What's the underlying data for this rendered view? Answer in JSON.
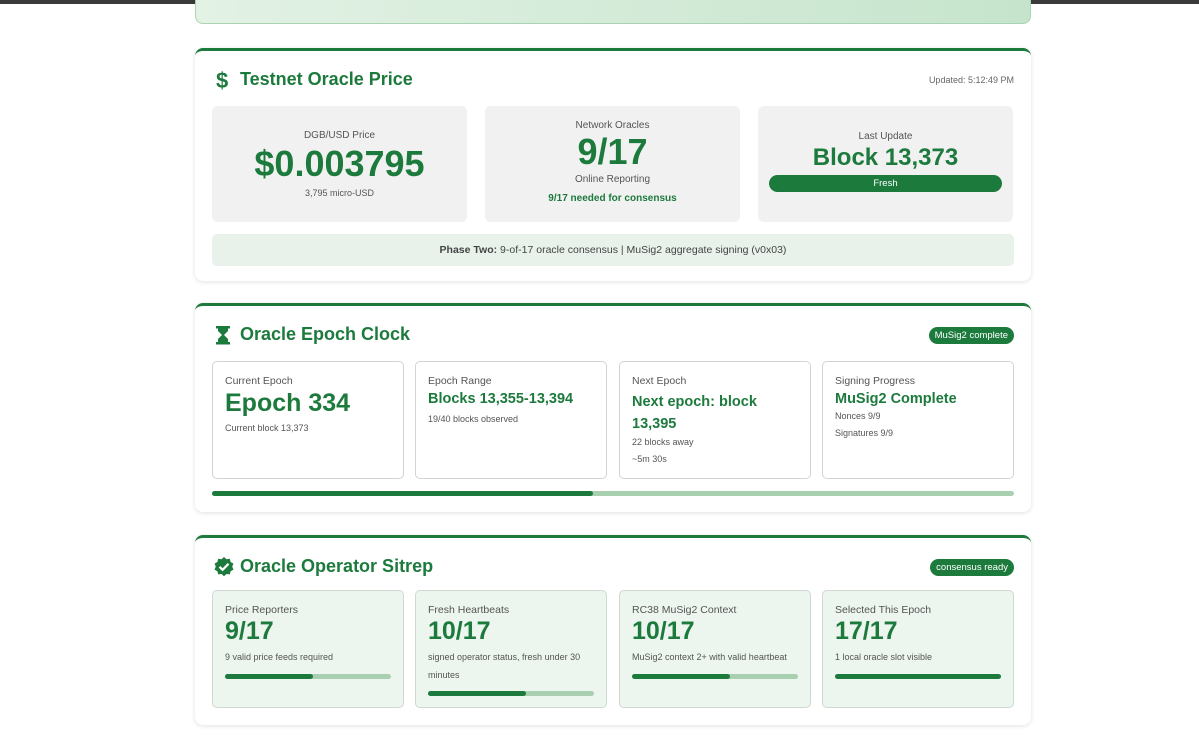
{
  "price_card": {
    "title": "Testnet Oracle Price",
    "icon": "dollar-icon",
    "updated": "Updated: 5:12:49 PM",
    "price": {
      "label": "DGB/USD Price",
      "value": "$0.003795",
      "sub": "3,795 micro-USD"
    },
    "oracles": {
      "label": "Network Oracles",
      "value": "9/17",
      "sub": "Online Reporting",
      "note": "9/17 needed for consensus"
    },
    "last_update": {
      "label": "Last Update",
      "value": "Block 13,373",
      "status": "Fresh"
    },
    "phase_bold": "Phase Two:",
    "phase_text": " 9-of-17 oracle consensus | MuSig2 aggregate signing (v0x03)"
  },
  "epoch_card": {
    "title": "Oracle Epoch Clock",
    "icon": "hourglass-icon",
    "badge": "MuSig2 complete",
    "current": {
      "label": "Current Epoch",
      "value": "Epoch 334",
      "sub": "Current block 13,373"
    },
    "range": {
      "label": "Epoch Range",
      "value": "Blocks 13,355-13,394",
      "sub": "19/40 blocks observed"
    },
    "next": {
      "label": "Next Epoch",
      "value": "Next epoch: block 13,395",
      "sub1": "22 blocks away",
      "sub2": "~5m 30s"
    },
    "signing": {
      "label": "Signing Progress",
      "value": "MuSig2 Complete",
      "sub1": "Nonces 9/9",
      "sub2": "Signatures 9/9"
    },
    "progress": 0.475
  },
  "sitrep_card": {
    "title": "Oracle Operator Sitrep",
    "icon": "verified-check-icon",
    "badge": "consensus ready",
    "items": [
      {
        "label": "Price Reporters",
        "value": "9/17",
        "sub": "9 valid price feeds required",
        "progress": 0.53
      },
      {
        "label": "Fresh Heartbeats",
        "value": "10/17",
        "sub": "signed operator status, fresh under 30 minutes",
        "progress": 0.59
      },
      {
        "label": "RC38 MuSig2 Context",
        "value": "10/17",
        "sub": "MuSig2 context 2+ with valid heartbeat",
        "progress": 0.59
      },
      {
        "label": "Selected This Epoch",
        "value": "17/17",
        "sub": "1 local oracle slot visible",
        "progress": 1.0
      }
    ]
  },
  "colors": {
    "accent": "#1d7a3d",
    "accent_light": "#a8d0b0",
    "panel": "#f1f1f1"
  }
}
